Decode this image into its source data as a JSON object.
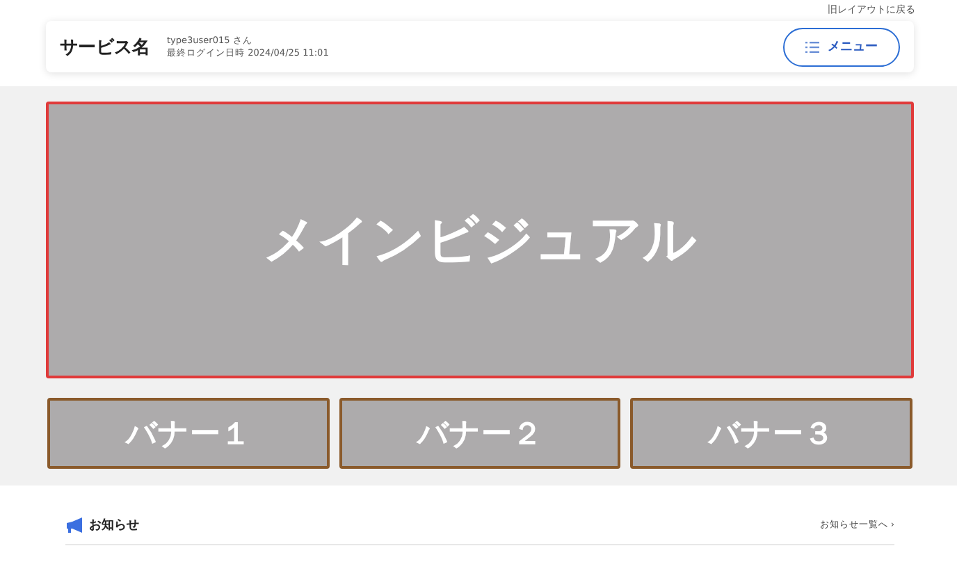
{
  "top_link": "旧レイアウトに戻る",
  "header": {
    "service_name": "サービス名",
    "user": "type3user015 さん",
    "last_login": "最終ログイン日時 2024/04/25 11:01",
    "menu_button": "メニュー"
  },
  "main_visual": {
    "label": "メインビジュアル"
  },
  "banners": [
    {
      "label": "バナー１"
    },
    {
      "label": "バナー２"
    },
    {
      "label": "バナー３"
    }
  ],
  "news": {
    "title": "お知らせ",
    "link": "お知らせ一覧へ",
    "link_arrow": "›"
  }
}
